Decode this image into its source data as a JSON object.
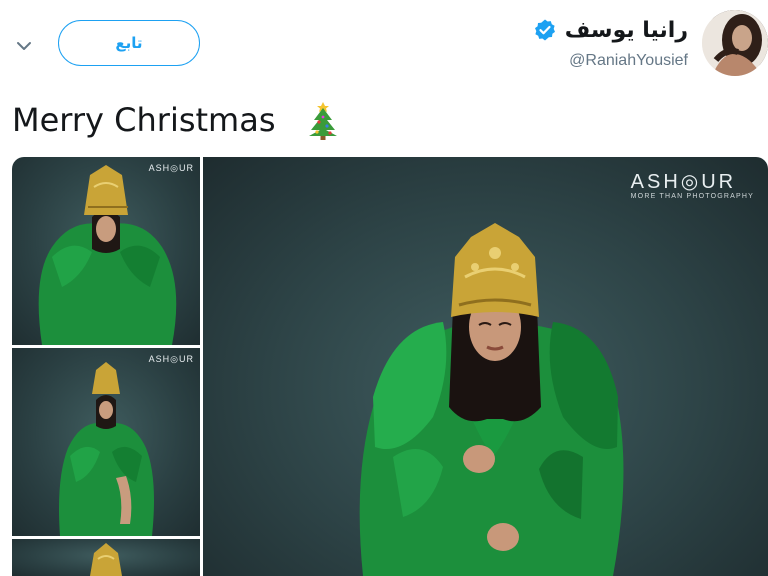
{
  "tweet": {
    "author": {
      "display_name": "رانيا يوسف",
      "handle": "@RaniahYousief",
      "verified": true
    },
    "follow_label": "تابع",
    "text": "Merry Christmas",
    "emoji": "christmas-tree-icon",
    "media": {
      "watermark_brand": "ASH◎UR",
      "watermark_tagline": "MORE THAN PHOTOGRAPHY",
      "thumb_watermark": "ASH◎UR"
    }
  },
  "colors": {
    "accent": "#1da1f2",
    "text": "#14171a",
    "muted": "#657786",
    "dress_green": "#1a8a3a",
    "crown_gold": "#c9a437"
  }
}
